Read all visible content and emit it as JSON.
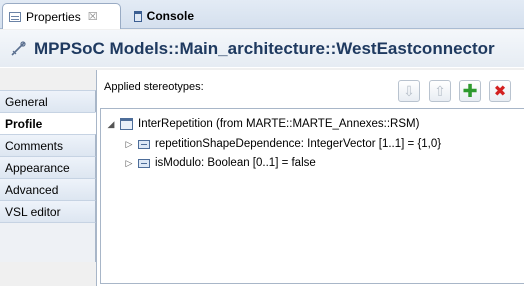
{
  "tabs": [
    {
      "label": "Properties",
      "close": "☒"
    },
    {
      "label": "Console"
    }
  ],
  "title": "MPPSoC Models::Main_architecture::WestEastconnector",
  "sections": [
    {
      "label": "General"
    },
    {
      "label": "Profile"
    },
    {
      "label": "Comments"
    },
    {
      "label": "Appearance"
    },
    {
      "label": "Advanced"
    },
    {
      "label": "VSL editor"
    }
  ],
  "selected_section": "Profile",
  "applied": {
    "label": "Applied stereotypes:",
    "buttons": {
      "down": "⇩",
      "up": "⇧",
      "add": "✚",
      "remove": "✖"
    }
  },
  "tree": {
    "root": {
      "label": "InterRepetition    (from MARTE::MARTE_Annexes::RSM)",
      "expanded": true
    },
    "children": [
      {
        "label": "repetitionShapeDependence: IntegerVector [1..1] = {1,0}"
      },
      {
        "label": "isModulo: Boolean [0..1] = false"
      }
    ],
    "twisty_expanded": "◢",
    "twisty_collapsed": "▷"
  }
}
